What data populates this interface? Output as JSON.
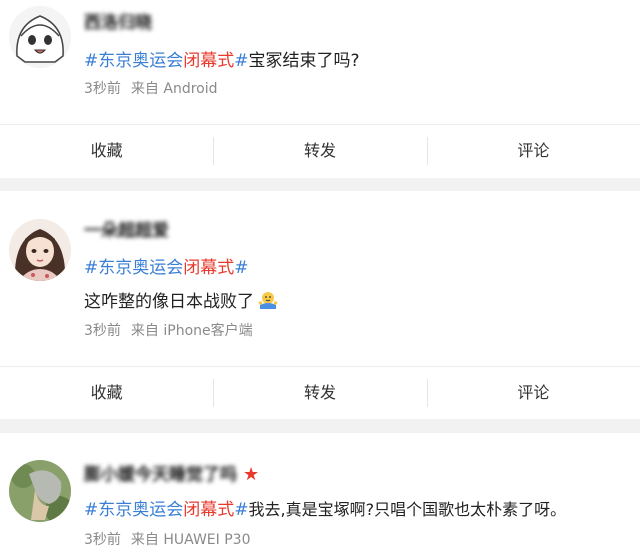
{
  "posts": [
    {
      "username": "西洛归晓",
      "hashtag_prefix": "#东京奥运会",
      "hashtag_red": "闭幕式",
      "hashtag_suffix": "#",
      "text": "宝冢结束了吗?",
      "time": "3秒前",
      "source": "来自 Android"
    },
    {
      "username": "一朵超超爱",
      "hashtag_prefix": "#东京奥运会",
      "hashtag_red": "闭幕式",
      "hashtag_suffix": "#",
      "text": "这咋整的像日本战败了",
      "emoji": "shrug-emoji",
      "time": "3秒前",
      "source": "来自 iPhone客户端"
    },
    {
      "username": "膨小媛今天睡觉了吗",
      "badge": "star-icon",
      "hashtag_prefix": "#东京奥运会",
      "hashtag_red": "闭幕式",
      "hashtag_suffix": "#",
      "text": "我去,真是宝塚啊?只唱个国歌也太朴素了呀。",
      "time": "3秒前",
      "source": "来自 HUAWEI P30"
    }
  ],
  "actions": {
    "favorite": "收藏",
    "repost": "转发",
    "comment": "评论"
  },
  "colors": {
    "hashtag": "#3a7fd5",
    "hashtag_highlight": "#e8392d",
    "meta": "#8a8a8a"
  }
}
